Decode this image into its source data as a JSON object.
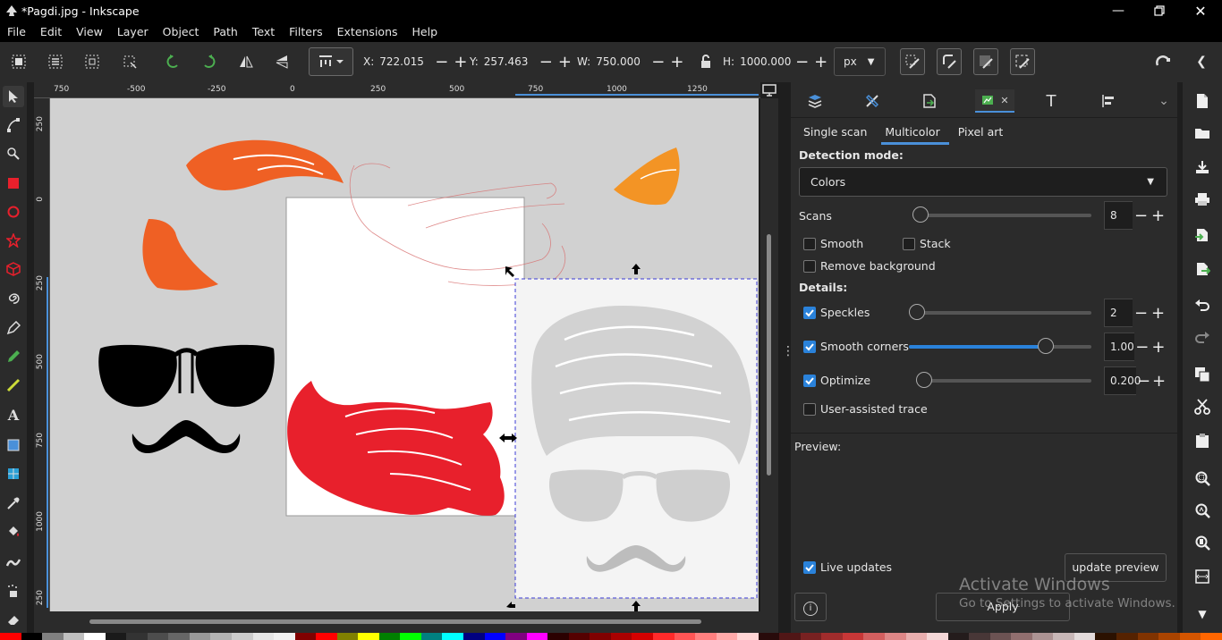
{
  "window": {
    "title": "*Pagdi.jpg - Inkscape"
  },
  "menu": [
    "File",
    "Edit",
    "View",
    "Layer",
    "Object",
    "Path",
    "Text",
    "Filters",
    "Extensions",
    "Help"
  ],
  "toolbar": {
    "x_label": "X:",
    "x_value": "722.015",
    "y_label": "Y:",
    "y_value": "257.463",
    "w_label": "W:",
    "w_value": "750.000",
    "h_label": "H:",
    "h_value": "1000.000",
    "unit": "px"
  },
  "ruler": {
    "top": [
      "750",
      "-500",
      "-250",
      "0",
      "250",
      "500",
      "750",
      "1000",
      "1250"
    ],
    "left": [
      "250",
      "0",
      "250",
      "500",
      "750",
      "1000",
      "250"
    ]
  },
  "trace": {
    "tabs": [
      "Single scan",
      "Multicolor",
      "Pixel art"
    ],
    "active_tab": "Multicolor",
    "detection_mode_label": "Detection mode:",
    "detection_mode_value": "Colors",
    "scans_label": "Scans",
    "scans_value": "8",
    "scans_level": 0.0,
    "smooth_label": "Smooth",
    "stack_label": "Stack",
    "remove_bg_label": "Remove background",
    "details_label": "Details:",
    "speckles_label": "Speckles",
    "speckles_value": "2",
    "speckles_level": 0.0,
    "smooth_corners_label": "Smooth corners",
    "smooth_corners_value": "1.00",
    "smooth_corners_level": 0.75,
    "optimize_label": "Optimize",
    "optimize_value": "0.200",
    "optimize_level": 0.0,
    "user_assisted_label": "User-assisted trace",
    "preview_label": "Preview:",
    "live_updates_label": "Live updates",
    "update_preview_label": "update preview",
    "apply_label": "Apply"
  },
  "watermark": {
    "line1": "Activate Windows",
    "line2": "Go to Settings to activate Windows."
  },
  "colors": {
    "accent": "#2a82da",
    "turban_orange": "#ef6024",
    "turban_light_orange": "#f39425",
    "turban_red": "#e8202c"
  },
  "palette": [
    "#ff0000",
    "#000000",
    "#808080",
    "#c0c0c0",
    "#ffffff",
    "#1a1a1a",
    "#333333",
    "#4d4d4d",
    "#666666",
    "#999999",
    "#b3b3b3",
    "#cccccc",
    "#e6e6e6",
    "#f2f2f2",
    "#800000",
    "#ff0000",
    "#808000",
    "#ffff00",
    "#008000",
    "#00ff00",
    "#008080",
    "#00ffff",
    "#000080",
    "#0000ff",
    "#800080",
    "#ff00ff",
    "#2b0000",
    "#550000",
    "#800000",
    "#aa0000",
    "#d40000",
    "#ff2a2a",
    "#ff5555",
    "#ff8080",
    "#ffaaaa",
    "#ffd5d5",
    "#280b0b",
    "#501616",
    "#782121",
    "#a02c2c",
    "#c83737",
    "#d35f5f",
    "#de8787",
    "#e9afaf",
    "#f4d7d7",
    "#241c1c",
    "#483737",
    "#6c5353",
    "#916f6f",
    "#ac9393",
    "#c8b7b7",
    "#e3dbdb",
    "#2b1100",
    "#552200",
    "#803300",
    "#aa4400",
    "#d45500",
    "#ff6600"
  ]
}
